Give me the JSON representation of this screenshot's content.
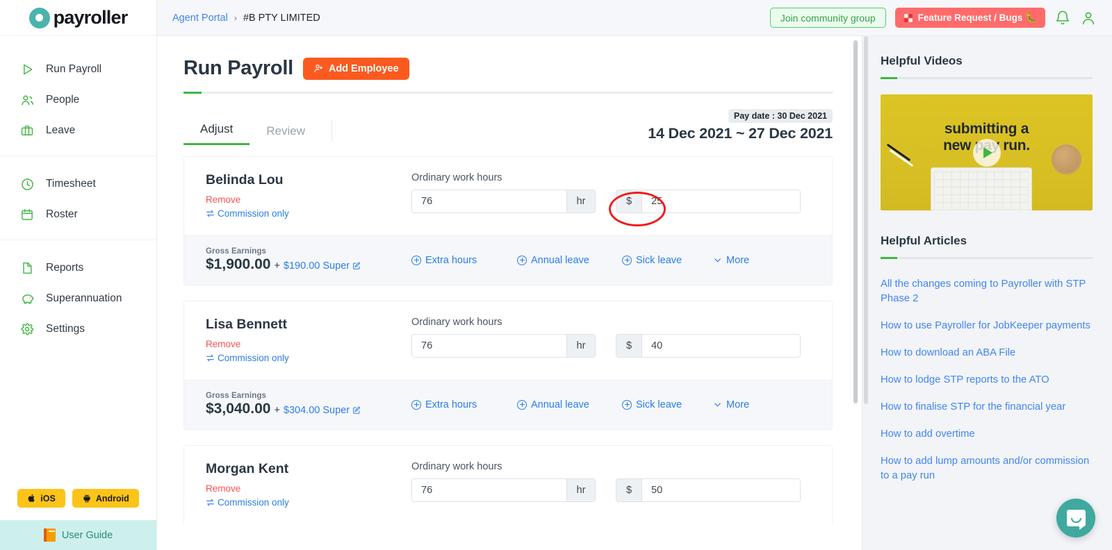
{
  "brand": {
    "name": "payroller",
    "accent": "#4cb3ac"
  },
  "sidebar": {
    "groups": [
      {
        "items": [
          {
            "label": "Run Payroll",
            "icon": "play-icon"
          },
          {
            "label": "People",
            "icon": "people-icon"
          },
          {
            "label": "Leave",
            "icon": "briefcase-icon"
          }
        ]
      },
      {
        "items": [
          {
            "label": "Timesheet",
            "icon": "clock-icon"
          },
          {
            "label": "Roster",
            "icon": "calendar-icon"
          }
        ]
      },
      {
        "items": [
          {
            "label": "Reports",
            "icon": "document-icon"
          },
          {
            "label": "Superannuation",
            "icon": "piggy-bank-icon"
          },
          {
            "label": "Settings",
            "icon": "gear-icon"
          }
        ]
      }
    ],
    "ios_label": "iOS",
    "android_label": "Android",
    "user_guide_label": "User Guide"
  },
  "topbar": {
    "breadcrumb_link": "Agent Portal",
    "breadcrumb_sep": "›",
    "breadcrumb_current": "#B PTY LIMITED",
    "community_label": "Join community group",
    "feature_label": "Feature Request / Bugs 🐛",
    "bell_icon": "bell-icon",
    "account_icon": "user-icon"
  },
  "main": {
    "title": "Run Payroll",
    "add_employee_label": "Add Employee",
    "tabs": [
      {
        "label": "Adjust",
        "active": true
      },
      {
        "label": "Review",
        "active": false
      }
    ],
    "pay_date_badge": "Pay date : 30 Dec 2021",
    "pay_period": "14 Dec 2021 ~ 27 Dec 2021",
    "field_label": "Ordinary work hours",
    "hours_suffix": "hr",
    "rate_prefix": "$",
    "remove_label": "Remove",
    "commission_label": "Commission only",
    "gross_label": "Gross Earnings",
    "plus_sign": "+",
    "super_suffix": "Super",
    "actions": [
      {
        "label": "Extra hours"
      },
      {
        "label": "Annual leave"
      },
      {
        "label": "Sick leave"
      },
      {
        "label": "More"
      }
    ],
    "employees": [
      {
        "name": "Belinda Lou",
        "hours": "76",
        "rate": "25",
        "gross": "$1,900.00",
        "super": "$190.00",
        "highlighted": true
      },
      {
        "name": "Lisa Bennett",
        "hours": "76",
        "rate": "40",
        "gross": "$3,040.00",
        "super": "$304.00",
        "highlighted": false
      },
      {
        "name": "Morgan Kent",
        "hours": "76",
        "rate": "50",
        "gross": "",
        "super": "",
        "highlighted": false
      }
    ]
  },
  "right_panel": {
    "videos_title": "Helpful Videos",
    "video_caption_line1": "submitting a",
    "video_caption_line2": "new pay run.",
    "articles_title": "Helpful Articles",
    "articles": [
      "All the changes coming to Payroller with STP Phase 2",
      "How to use Payroller for JobKeeper payments",
      "How to download an ABA File",
      "How to lodge STP reports to the ATO",
      "How to finalise STP for the financial year",
      "How to add overtime",
      "How to add lump amounts and/or commission to a pay run"
    ],
    "chat_icon": "chat-bubble-icon"
  },
  "annotation": {
    "shape": "ellipse",
    "color": "#f01c1c",
    "target": "rate-input-belinda-lou"
  }
}
